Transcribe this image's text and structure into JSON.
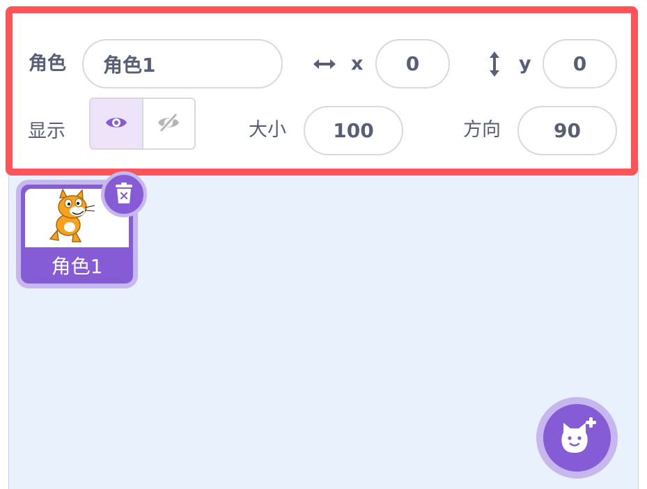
{
  "sprite_info": {
    "sprite_label": "角色",
    "sprite_name": "角色1",
    "x_label": "x",
    "x_value": "0",
    "y_label": "y",
    "y_value": "0",
    "show_label": "显示",
    "visibility": "shown",
    "size_label": "大小",
    "size_value": "100",
    "direction_label": "方向",
    "direction_value": "90"
  },
  "sprite_list": {
    "items": [
      {
        "name": "角色1",
        "selected": true
      }
    ]
  },
  "icons": {
    "x_axis": "horizontal-arrow-icon",
    "y_axis": "vertical-arrow-icon",
    "show": "eye-icon",
    "hide": "eye-slash-icon",
    "delete": "trash-icon",
    "add_sprite": "add-sprite-cat-icon"
  },
  "colors": {
    "highlight_border": "#fc5457",
    "accent": "#855cd6",
    "accent_light": "#c6b8ef",
    "pane_bg": "#e9f1fc",
    "text": "#575e75"
  }
}
